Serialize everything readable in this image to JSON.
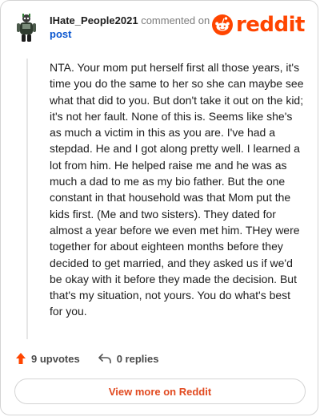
{
  "header": {
    "username": "IHate_People2021",
    "action_text": " commented on",
    "post_link": "post",
    "logo_text": "reddit"
  },
  "comment": {
    "body": "NTA. Your mom put herself first all those years, it's time you do the same to her so she can maybe see what that did to you. But don't take it out on the kid; it's not her fault. None of this is. Seems like she's as much a victim in this as you are. I've had a stepdad. He and I got along pretty well. I learned a lot from him. He helped raise me and he was as much a dad to me as my bio father. But the one constant in that household was that Mom put the kids first. (Me and two sisters). They dated for almost a year before we even met him. THey were together for about eighteen months before they decided to get married, and they asked us if we'd be okay with it before they made the decision. But that's my situation, not yours. You do what's best for you."
  },
  "actions": {
    "upvotes_label": "9 upvotes",
    "replies_label": "0 replies"
  },
  "footer": {
    "view_more_label": "View more on Reddit"
  },
  "colors": {
    "brand": "#ff4500",
    "link": "#0b57d0"
  },
  "icons": {
    "avatar": "snoo-avatar-icon",
    "logo": "reddit-snoo-icon",
    "upvote": "upvote-arrow-icon",
    "reply": "reply-arrow-icon"
  }
}
